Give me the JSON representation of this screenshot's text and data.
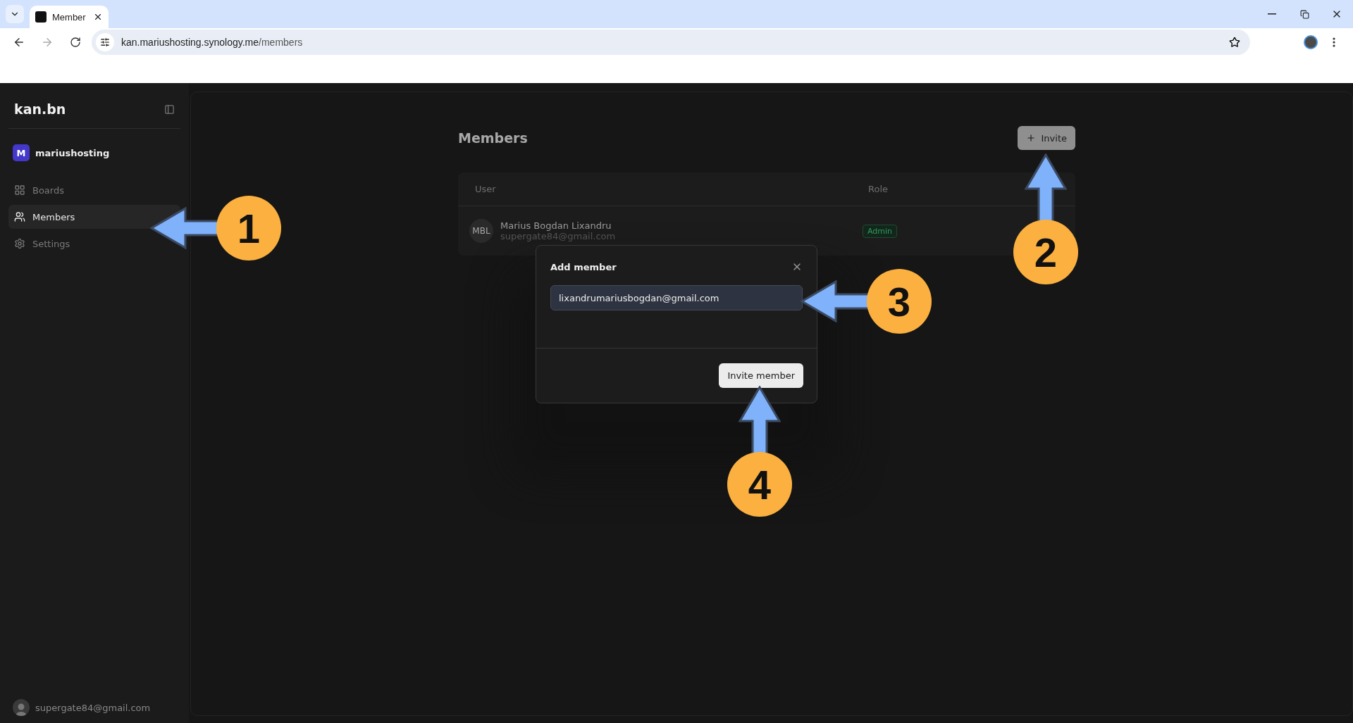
{
  "browser": {
    "tab_title": "Member",
    "url_host": "kan.mariushosting.synology.me",
    "url_path": "/members"
  },
  "sidebar": {
    "logo": "kan.bn",
    "workspace": {
      "initial": "M",
      "name": "mariushosting"
    },
    "items": [
      {
        "label": "Boards",
        "kind": "boards",
        "selected": false
      },
      {
        "label": "Members",
        "kind": "members",
        "selected": true
      },
      {
        "label": "Settings",
        "kind": "settings",
        "selected": false
      }
    ],
    "user_email": "supergate84@gmail.com"
  },
  "page": {
    "title": "Members",
    "invite_button": "Invite",
    "table": {
      "columns": [
        "User",
        "Role"
      ],
      "rows": [
        {
          "initials": "MBL",
          "name": "Marius Bogdan Lixandru",
          "email": "supergate84@gmail.com",
          "role": "Admin"
        }
      ]
    }
  },
  "dialog": {
    "title": "Add member",
    "email_value": "lixandrumariusbogdan@gmail.com",
    "submit": "Invite member"
  },
  "annotations": [
    {
      "number": "1",
      "kind": "left"
    },
    {
      "number": "2",
      "kind": "up"
    },
    {
      "number": "3",
      "kind": "left"
    },
    {
      "number": "4",
      "kind": "up"
    }
  ]
}
